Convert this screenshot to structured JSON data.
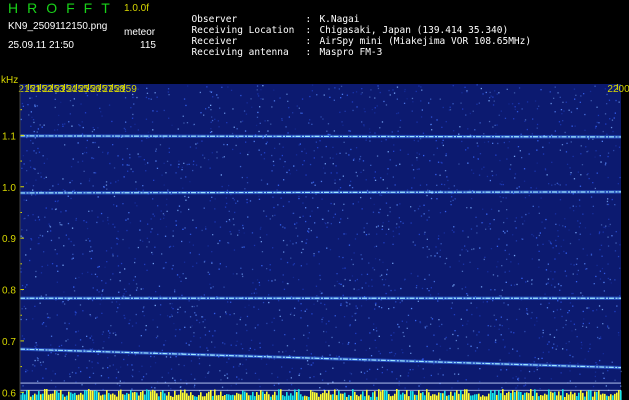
{
  "header": {
    "app_title": "HROFFT",
    "version": "1.0.0f",
    "filename": "KN9_2509112150.png",
    "mode": "meteor",
    "datetime": "25.09.11 21:50",
    "count": "115",
    "meta": [
      {
        "key": "Observer",
        "value": "K.Nagai"
      },
      {
        "key": "Receiving Location",
        "value": "Chigasaki, Japan (139.414 35.340)"
      },
      {
        "key": "Receiver",
        "value": "AirSpy mini (Miakejima VOR 108.65MHz)"
      },
      {
        "key": "Receiving antenna",
        "value": "Maspro FM-3"
      }
    ]
  },
  "chart_data": {
    "type": "heatmap",
    "ylabel": "kHz",
    "xlim": [
      2150.3,
      2200.3
    ],
    "ylim": [
      0.585,
      1.2
    ],
    "x_ticks": [
      "2151",
      "2152",
      "2153",
      "2154",
      "2155",
      "2156",
      "2157",
      "2158",
      "2159",
      "2200"
    ],
    "x_tick_values": [
      2151,
      2152,
      2153,
      2154,
      2155,
      2156,
      2157,
      2158,
      2159,
      2200
    ],
    "y_ticks": [
      "1.1",
      "1.0",
      "0.9",
      "0.8",
      "0.7",
      "0.6"
    ],
    "y_tick_values": [
      1.1,
      1.0,
      0.9,
      0.8,
      0.7,
      0.6
    ],
    "signal_lines": [
      {
        "freq_start": 1.099,
        "freq_end": 1.097
      },
      {
        "freq_start": 0.988,
        "freq_end": 0.99
      },
      {
        "freq_start": 0.783,
        "freq_end": 0.783
      },
      {
        "freq_start": 0.684,
        "freq_end": 0.648
      },
      {
        "freq_start": 0.618,
        "freq_end": 0.618
      },
      {
        "freq_start": 0.604,
        "freq_end": 0.604
      }
    ],
    "colors": {
      "background": "#0c1a70",
      "noise": "#3a6aff",
      "signal": "#9ee8ff",
      "ticks": "#d8d800",
      "power_bar": "#ffff30"
    }
  }
}
